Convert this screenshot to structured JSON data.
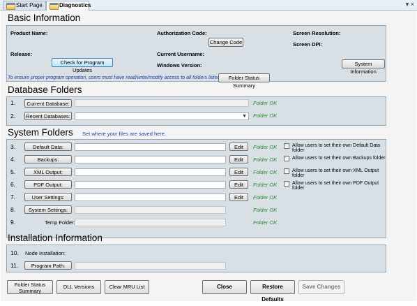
{
  "tabs": [
    {
      "label": "Start Page",
      "active": false
    },
    {
      "label": "Diagnostics",
      "active": true
    }
  ],
  "close_all": "▾ ×",
  "basic": {
    "title": "Basic Information",
    "product_name_label": "Product Name:",
    "release_label": "Release:",
    "check_updates_btn": "Check for Program Updates",
    "auth_code_label": "Authorization Code:",
    "change_code_btn": "Change Code",
    "current_username_label": "Current Username:",
    "windows_version_label": "Windows Version:",
    "screen_resolution_label": "Screen Resolution:",
    "screen_dpi_label": "Screen DPI:",
    "system_info_btn": "System Information"
  },
  "access_note": "To ensure proper program operation, users must have read/write/modify access to all folders listed below.",
  "folder_status_summary_btn": "Folder Status Summary",
  "database": {
    "title": "Database Folders",
    "rows": [
      {
        "num": "1.",
        "button": "Current Database:",
        "value": "",
        "status": "Folder OK"
      },
      {
        "num": "2.",
        "button": "Recent Databases:",
        "value": "",
        "status": "Folder OK"
      }
    ]
  },
  "system": {
    "title": "System Folders",
    "subtitle": "Set where your files are saved here.",
    "edit_label": "Edit",
    "rows": [
      {
        "num": "3.",
        "button": "Default Data:",
        "value": "",
        "status": "Folder OK",
        "checkbox": "Allow users to set their own Default Data folder"
      },
      {
        "num": "4.",
        "button": "Backups:",
        "value": "",
        "status": "Folder OK",
        "checkbox": "Allow users to set their own Backups folder"
      },
      {
        "num": "5.",
        "button": "XML Output:",
        "value": "",
        "status": "Folder OK",
        "checkbox": "Allow users to set their own XML Output folder"
      },
      {
        "num": "6.",
        "button": "PDF Output:",
        "value": "",
        "status": "Folder OK",
        "checkbox": "Allow users to set their own PDF Output folder"
      },
      {
        "num": "7.",
        "button": "User Settings:",
        "value": "",
        "status": "Folder OK"
      },
      {
        "num": "8.",
        "button": "System Settings:",
        "value": "",
        "status": "Folder OK"
      },
      {
        "num": "9.",
        "label": "Temp Folder:",
        "value": "",
        "status": "Folder OK"
      }
    ]
  },
  "install": {
    "title": "Installation Information",
    "rows": [
      {
        "num": "10.",
        "label": "Node Installation:"
      },
      {
        "num": "11.",
        "button": "Program Path:",
        "value": ""
      }
    ]
  },
  "bottom": {
    "folder_status_summary": [
      "Folder Status",
      "Summary"
    ],
    "dll_versions": "DLL Versions",
    "clear_mru": "Clear MRU List",
    "close": "Close",
    "restore_defaults": "Restore Defaults",
    "save_changes": "Save Changes"
  },
  "colors": {
    "panel_bg": "#d8e0e6",
    "ok_green": "#2e8b2e",
    "note_blue": "#1a3fa8"
  }
}
